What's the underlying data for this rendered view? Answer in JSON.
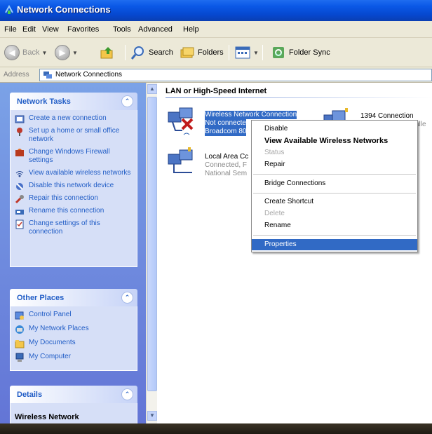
{
  "window": {
    "title": "Network Connections"
  },
  "menu": [
    "File",
    "Edit",
    "View",
    "Favorites",
    "Tools",
    "Advanced",
    "Help"
  ],
  "toolbar": {
    "back": "Back",
    "search": "Search",
    "folders": "Folders",
    "folder_sync": "Folder Sync"
  },
  "address": {
    "label": "Address",
    "value": "Network Connections"
  },
  "network_tasks": {
    "title": "Network Tasks",
    "items": [
      "Create a new connection",
      "Set up a home or small office network",
      "Change Windows Firewall settings",
      "View available wireless networks",
      "Disable this network device",
      "Repair this connection",
      "Rename this connection",
      "Change settings of this connection"
    ]
  },
  "other_places": {
    "title": "Other Places",
    "items": [
      "Control Panel",
      "My Network Places",
      "My Documents",
      "My Computer"
    ]
  },
  "details": {
    "title": "Details",
    "item": "Wireless Network"
  },
  "main": {
    "section_title": "LAN or High-Speed Internet",
    "connections": [
      {
        "name": "Wireless Network Connection",
        "status": "Not connecte",
        "device": "Broadcom 80"
      },
      {
        "name": "Local Area Cc",
        "status": "Connected, F",
        "device": "National Sem"
      },
      {
        "name": "1394 Connection",
        "status": "",
        "device": "alle"
      }
    ]
  },
  "context_menu": {
    "items": [
      {
        "label": "Disable",
        "state": "normal"
      },
      {
        "label": "View Available Wireless Networks",
        "state": "bold"
      },
      {
        "label": "Status",
        "state": "disabled"
      },
      {
        "label": "Repair",
        "state": "normal"
      },
      {
        "label": "Bridge Connections",
        "state": "normal"
      },
      {
        "label": "Create Shortcut",
        "state": "normal"
      },
      {
        "label": "Delete",
        "state": "disabled"
      },
      {
        "label": "Rename",
        "state": "normal"
      },
      {
        "label": "Properties",
        "state": "highlighted"
      }
    ]
  },
  "colors": {
    "titlebar": "#0a58e6",
    "task_pane": "#6375d6",
    "selection": "#316ac5",
    "link": "#215dc6"
  }
}
